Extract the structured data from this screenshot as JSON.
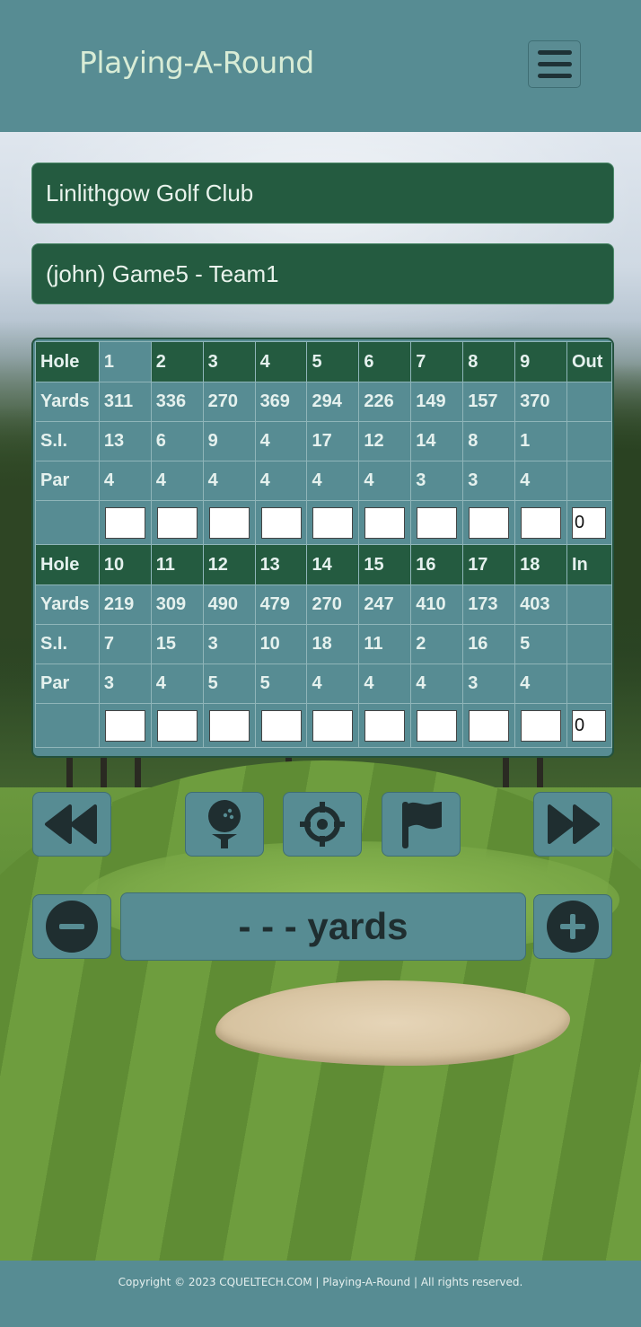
{
  "app": {
    "brand": "Playing-A-Round",
    "menu_icon": "hamburger-icon"
  },
  "club_name": "Linlithgow Golf Club",
  "game_name": "(john) Game5 - Team1",
  "scorecard": {
    "front": {
      "hole_label": "Hole",
      "holes": [
        "1",
        "2",
        "3",
        "4",
        "5",
        "6",
        "7",
        "8",
        "9"
      ],
      "total_label": "Out",
      "yards_label": "Yards",
      "yards": [
        "311",
        "336",
        "270",
        "369",
        "294",
        "226",
        "149",
        "157",
        "370"
      ],
      "si_label": "S.I.",
      "si": [
        "13",
        "6",
        "9",
        "4",
        "17",
        "12",
        "14",
        "8",
        "1"
      ],
      "par_label": "Par",
      "par": [
        "4",
        "4",
        "4",
        "4",
        "4",
        "4",
        "3",
        "3",
        "4"
      ],
      "total": "0"
    },
    "back": {
      "hole_label": "Hole",
      "holes": [
        "10",
        "11",
        "12",
        "13",
        "14",
        "15",
        "16",
        "17",
        "18"
      ],
      "total_label": "In",
      "yards_label": "Yards",
      "yards": [
        "219",
        "309",
        "490",
        "479",
        "270",
        "247",
        "410",
        "173",
        "403"
      ],
      "si_label": "S.I.",
      "si": [
        "7",
        "15",
        "3",
        "10",
        "18",
        "11",
        "2",
        "16",
        "5"
      ],
      "par_label": "Par",
      "par": [
        "3",
        "4",
        "5",
        "5",
        "4",
        "4",
        "4",
        "3",
        "4"
      ],
      "total": "0"
    },
    "current_hole": "1"
  },
  "controls": {
    "prev_icon": "rewind-icon",
    "tee_icon": "golf-ball-tee-icon",
    "target_icon": "crosshairs-icon",
    "flag_icon": "flag-icon",
    "next_icon": "fast-forward-icon",
    "minus_icon": "minus-circle-icon",
    "plus_icon": "plus-circle-icon",
    "distance": "- - - yards"
  },
  "footer": {
    "text": "Copyright © 2023 CQUELTECH.COM | Playing-A-Round | All rights reserved."
  },
  "colors": {
    "teal": "#578c93",
    "dark_green": "#245b40",
    "icon_dark": "#1f2e30"
  }
}
